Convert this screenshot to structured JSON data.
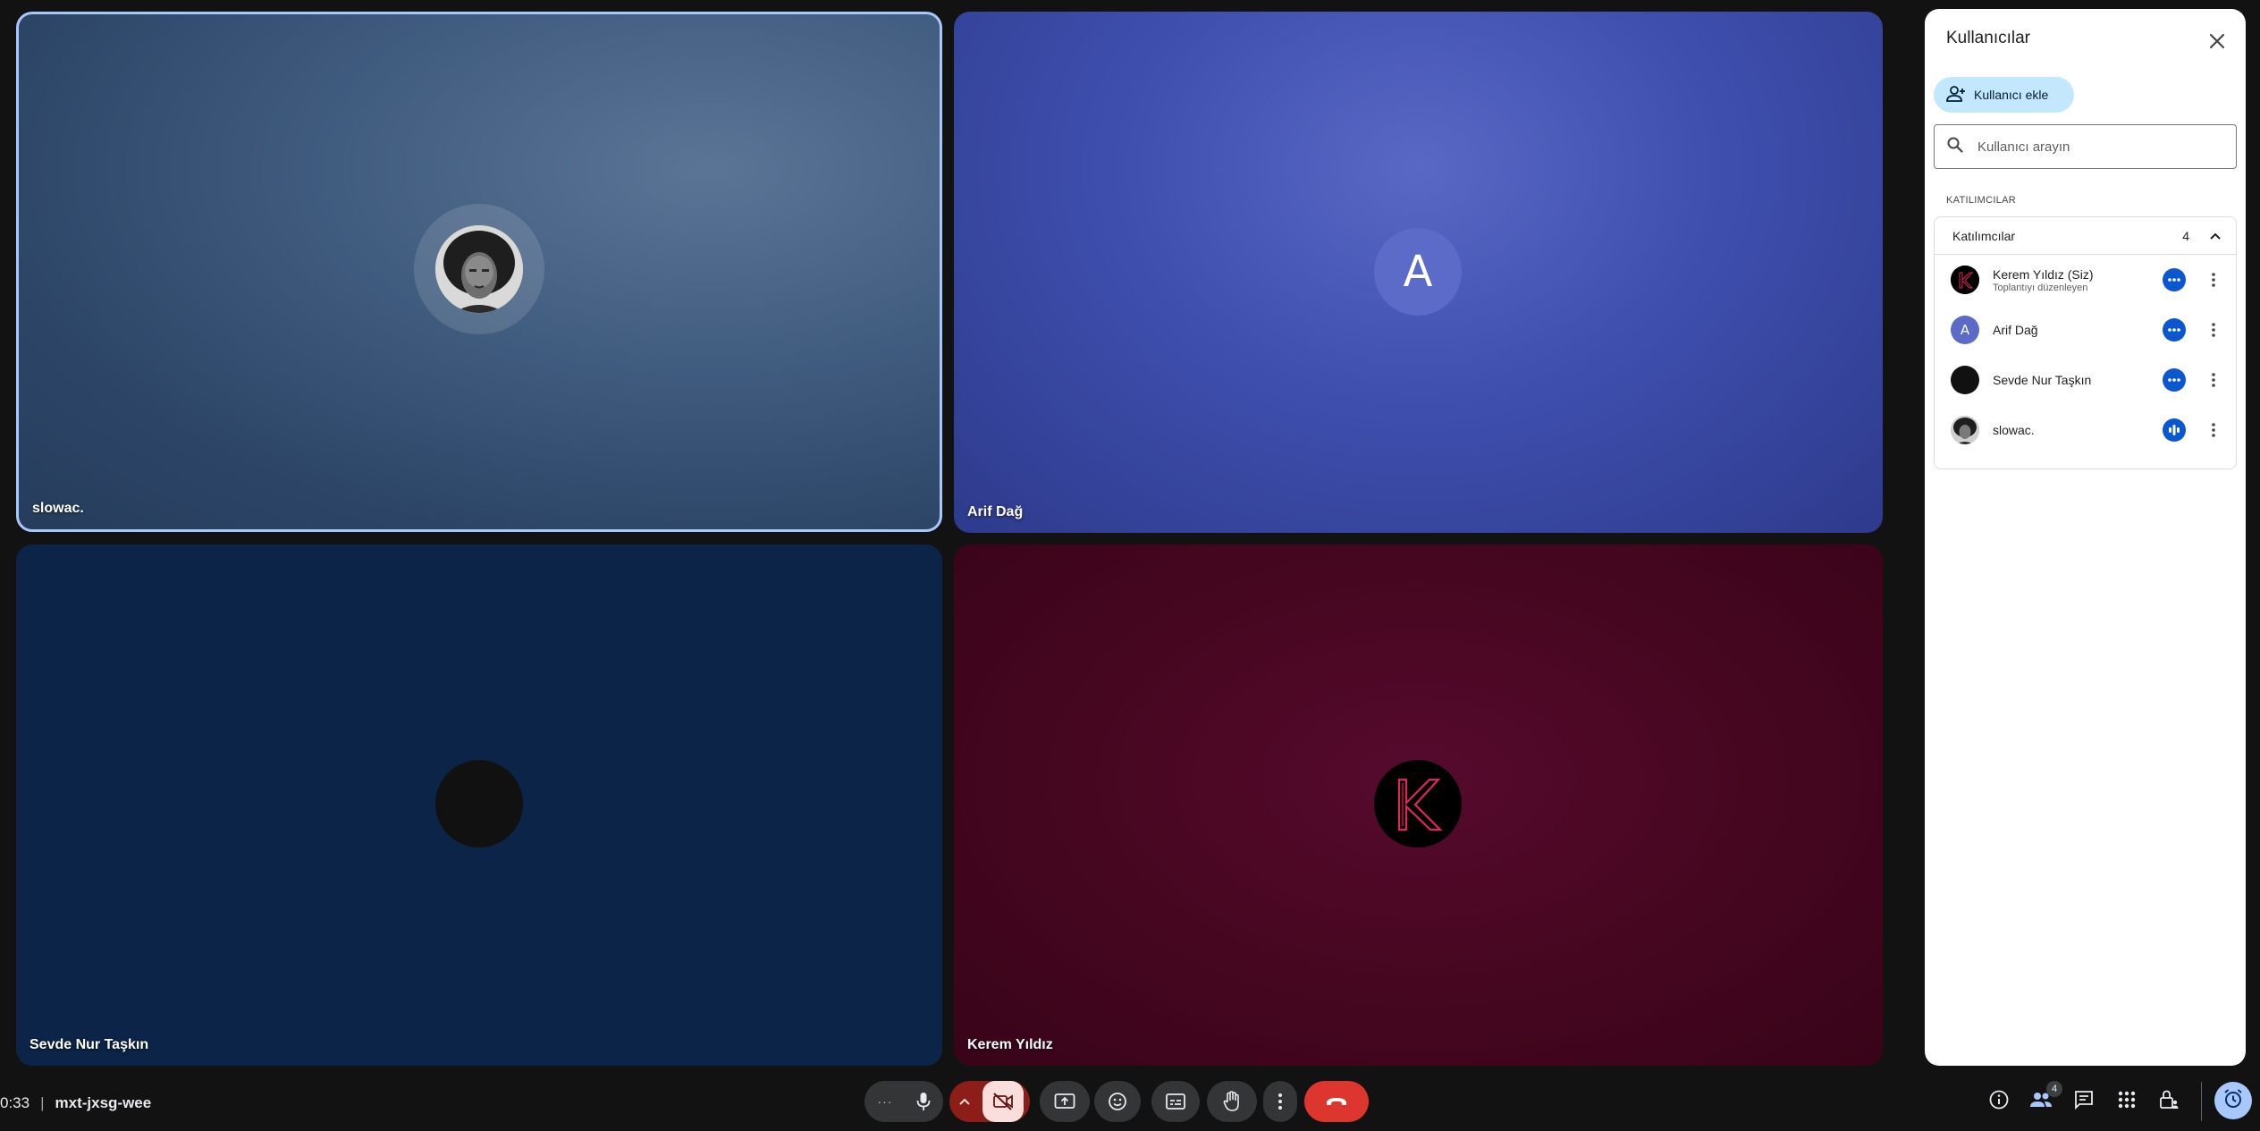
{
  "tiles": [
    {
      "name": "slowac.",
      "avatar": "photo-avatar",
      "active": true
    },
    {
      "name": "Arif Dağ",
      "avatar_letter": "A"
    },
    {
      "name": "Sevde Nur Taşkın",
      "avatar": "dark-avatar"
    },
    {
      "name": "Kerem Yıldız",
      "avatar": "k-logo-avatar"
    }
  ],
  "panel": {
    "title": "Kullanıcılar",
    "add_label": "Kullanıcı ekle",
    "search_placeholder": "Kullanıcı arayın",
    "section_caption": "KATILIMCILAR",
    "group": {
      "title": "Katılımcılar",
      "count": "4"
    },
    "participants": [
      {
        "name": "Kerem Yıldız (Siz)",
        "sub": "Toplantıyı düzenleyen",
        "status": "more-dots-icon"
      },
      {
        "name": "Arif Dağ",
        "avatar_letter": "A",
        "status": "more-dots-icon"
      },
      {
        "name": "Sevde Nur Taşkın",
        "status": "more-dots-icon"
      },
      {
        "name": "slowac.",
        "status": "audio-wave-icon"
      }
    ]
  },
  "bottom_bar": {
    "time": "0:33",
    "separator": "|",
    "meeting_code": "mxt-jxsg-wee",
    "more_label": "···",
    "people_badge": "4"
  },
  "colors": {
    "accent": "#a8c7fa",
    "end_call": "#dc362e",
    "camera_off": "#f9dedc",
    "status_blue": "#0b57d0"
  }
}
